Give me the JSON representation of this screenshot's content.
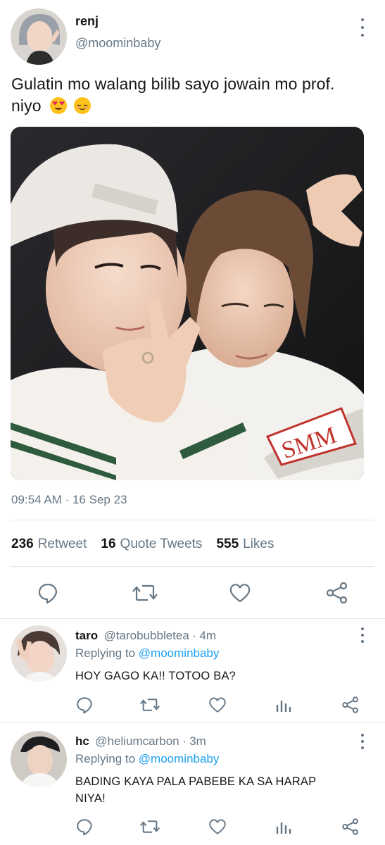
{
  "tweet": {
    "author_name": "renj",
    "author_handle": "@moominbaby",
    "text_line1": "Gulatin mo walang bilib sayo jowain mo prof.",
    "text_line2": "niyo",
    "emojis": [
      "smiling-face-with-heart-eyes",
      "relieved-face"
    ],
    "time": "09:54 AM",
    "date_sep": "·",
    "date": "16 Sep 23",
    "retweets_count": "236",
    "retweets_label": "Retweet",
    "quotes_count": "16",
    "quotes_label": "Quote Tweets",
    "likes_count": "555",
    "likes_label": "Likes"
  },
  "actions": [
    "reply-icon",
    "retweet-icon",
    "like-icon",
    "share-icon"
  ],
  "replies": [
    {
      "name": "taro",
      "handle": "@tarobubbletea",
      "sep": "·",
      "time": "4m",
      "replying_prefix": "Replying to",
      "replying_to": "@moominbaby",
      "text": "HOY GAGO KA!! TOTOO BA?"
    },
    {
      "name": "hc",
      "handle": "@heliumcarbon",
      "sep": "·",
      "time": "3m",
      "replying_prefix": "Replying to",
      "replying_to": "@moominbaby",
      "text_line1": "BADING KAYA PALA PABEBE KA SA HARAP",
      "text_line2": "NIYA!"
    }
  ],
  "colors": {
    "accent": "#1da1f2",
    "text": "#14171a",
    "muted": "#657786",
    "divider": "#e1e8ed"
  }
}
